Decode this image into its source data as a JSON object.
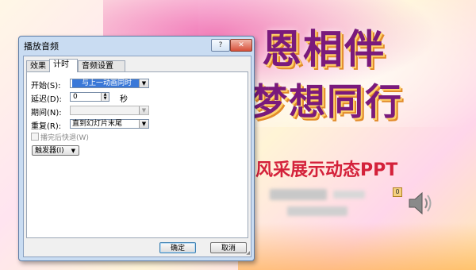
{
  "slide": {
    "title_line1": "恩相伴",
    "title_line2": "梦想同行",
    "subtitle": "风采展示动态PPT",
    "badge": "0",
    "speaker_icon": "speaker-icon"
  },
  "dialog": {
    "title": "播放音频",
    "help_label": "?",
    "close_label": "✕",
    "tabs": [
      {
        "label": "效果",
        "active": false
      },
      {
        "label": "计时",
        "active": true
      },
      {
        "label": "音频设置",
        "active": false
      }
    ],
    "start_label": "开始(S):",
    "start_value": "与上一动画同时",
    "delay_label": "延迟(D):",
    "delay_value": "0",
    "delay_unit": "秒",
    "duration_label": "期间(N):",
    "duration_value": "",
    "repeat_label": "重复(R):",
    "repeat_value": "直到幻灯片末尾",
    "rewind_label": "播完后快退(W)",
    "rewind_checked": false,
    "trigger_label": "触发器(I)",
    "ok_label": "确定",
    "cancel_label": "取消"
  },
  "colors": {
    "selection": "#3a78d8",
    "title_purple": "#7a1a7c",
    "subtitle_red": "#d4213a"
  }
}
